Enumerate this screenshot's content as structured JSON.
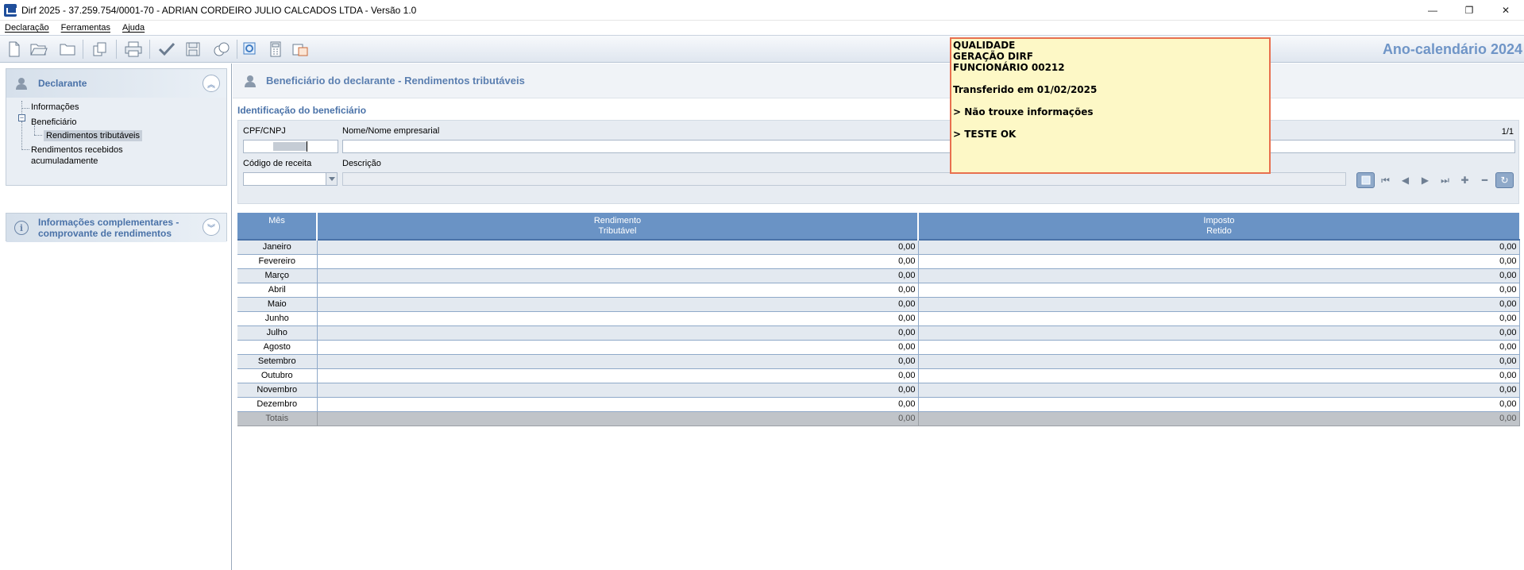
{
  "window": {
    "title": "Dirf 2025 - 37.259.754/0001-70 - ADRIAN CORDEIRO JULIO CALCADOS LTDA - Versão 1.0",
    "minimize": "—",
    "restore": "❐",
    "close": "✕"
  },
  "menu": [
    "Declaração",
    "Ferramentas",
    "Ajuda"
  ],
  "toolbar": {
    "year_label": "Ano-calendário 2024",
    "icons": [
      "new-file-icon",
      "open-folder-icon",
      "folder-icon",
      "copy-icon",
      "print-icon",
      "check-icon",
      "save-icon",
      "transmit-icon",
      "search-icon",
      "calculator-icon",
      "receipt-icon"
    ]
  },
  "left": {
    "declarante_title": "Declarante",
    "tree": {
      "informacoes": "Informações",
      "beneficiario": "Beneficiário",
      "rendimentos_tributaveis": "Rendimentos tributáveis",
      "rra_line1": "Rendimentos recebidos",
      "rra_line2": "acumuladamente"
    },
    "info_comp_line1": "Informações complementares -",
    "info_comp_line2": "comprovante de rendimentos"
  },
  "main": {
    "header_title": "Beneficiário do declarante - Rendimentos tributáveis",
    "section_title": "Identificação do beneficiário",
    "cpf_label": "CPF/CNPJ",
    "nome_label": "Nome/Nome empresarial",
    "codigo_label": "Código de receita",
    "descricao_label": "Descrição",
    "counter": "1/1"
  },
  "table": {
    "headers": {
      "mes": "Mês",
      "rend_line1": "Rendimento",
      "rend_line2": "Tributável",
      "imp_line1": "Imposto",
      "imp_line2": "Retido"
    },
    "rows": [
      {
        "mes": "Janeiro",
        "rendimento": "0,00",
        "imposto": "0,00"
      },
      {
        "mes": "Fevereiro",
        "rendimento": "0,00",
        "imposto": "0,00"
      },
      {
        "mes": "Março",
        "rendimento": "0,00",
        "imposto": "0,00"
      },
      {
        "mes": "Abril",
        "rendimento": "0,00",
        "imposto": "0,00"
      },
      {
        "mes": "Maio",
        "rendimento": "0,00",
        "imposto": "0,00"
      },
      {
        "mes": "Junho",
        "rendimento": "0,00",
        "imposto": "0,00"
      },
      {
        "mes": "Julho",
        "rendimento": "0,00",
        "imposto": "0,00"
      },
      {
        "mes": "Agosto",
        "rendimento": "0,00",
        "imposto": "0,00"
      },
      {
        "mes": "Setembro",
        "rendimento": "0,00",
        "imposto": "0,00"
      },
      {
        "mes": "Outubro",
        "rendimento": "0,00",
        "imposto": "0,00"
      },
      {
        "mes": "Novembro",
        "rendimento": "0,00",
        "imposto": "0,00"
      },
      {
        "mes": "Dezembro",
        "rendimento": "0,00",
        "imposto": "0,00"
      }
    ],
    "totals": {
      "mes": "Totais",
      "rendimento": "0,00",
      "imposto": "0,00"
    }
  },
  "note": {
    "lines": [
      "QUALIDADE",
      "GERAÇÃO DIRF",
      "FUNCIONÁRIO 00212",
      "",
      "Transferido em 01/02/2025",
      "",
      "> Não trouxe informações",
      "",
      "> TESTE OK"
    ]
  },
  "colors": {
    "accent": "#4a72a8",
    "table_header": "#6a93c5",
    "note_bg": "#fdf8c6",
    "note_border": "#e8704f"
  }
}
